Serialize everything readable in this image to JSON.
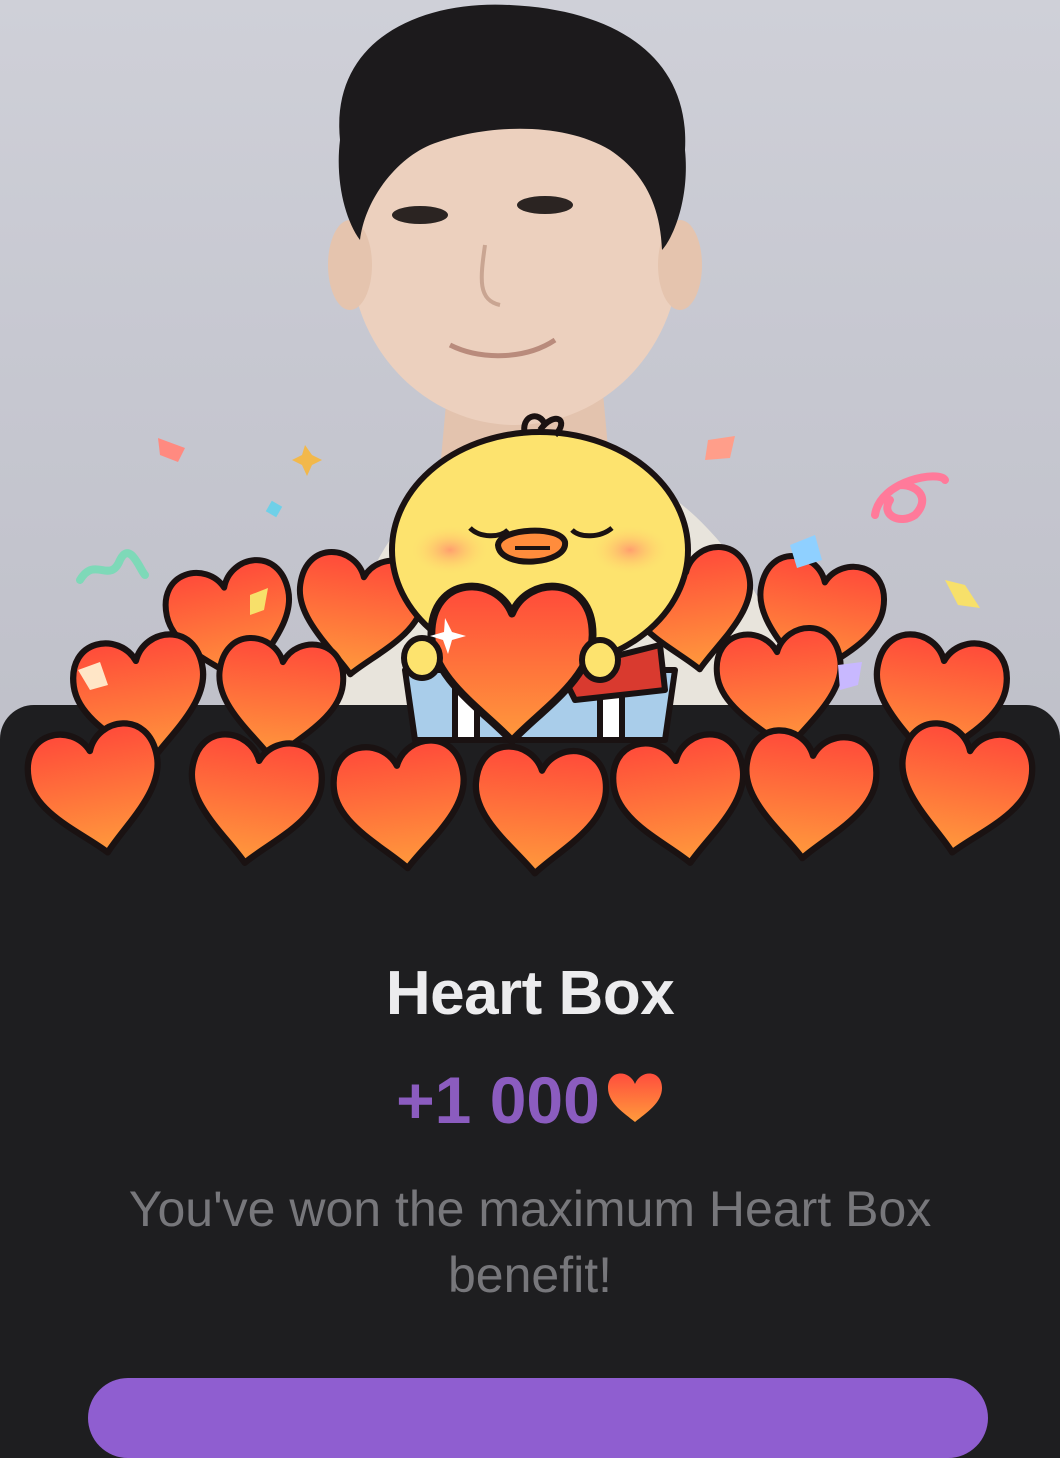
{
  "reward": {
    "title": "Heart Box",
    "amount": "+1 000",
    "message": "You've won the maximum Heart Box benefit!"
  },
  "icons": {
    "currency": "heart-icon",
    "mascot": "yellow-chick-character",
    "gift": "open-gift-box-icon"
  },
  "colors": {
    "accent": "#8b5cbf",
    "heart": "#ff5a3c",
    "sheet": "#1e1e20",
    "button": "#8f5ed0"
  }
}
